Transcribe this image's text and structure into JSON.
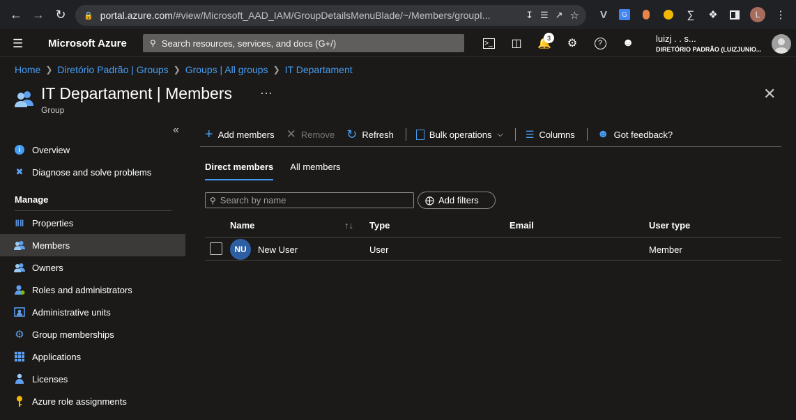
{
  "browser": {
    "url_host": "portal.azure.com",
    "url_path": "/#view/Microsoft_AAD_IAM/GroupDetailsMenuBlade/~/Members/groupI...",
    "profile_initial": "L"
  },
  "topbar": {
    "brand": "Microsoft Azure",
    "search_placeholder": "Search resources, services, and docs (G+/)",
    "notification_count": "3",
    "account_name": "luizj          .         .       s...",
    "account_directory": "DIRETÓRIO PADRÃO (LUIZJUNIO..."
  },
  "breadcrumb": [
    "Home",
    "Diretório Padrão | Groups",
    "Groups | All groups",
    "IT Departament"
  ],
  "page": {
    "title": "IT Departament | Members",
    "subtitle": "Group"
  },
  "sidebar": {
    "top_items": [
      {
        "label": "Overview",
        "icon": "info-icon"
      },
      {
        "label": "Diagnose and solve problems",
        "icon": "wrench-icon"
      }
    ],
    "section_header": "Manage",
    "manage_items": [
      {
        "label": "Properties",
        "icon": "properties-icon"
      },
      {
        "label": "Members",
        "icon": "members-icon"
      },
      {
        "label": "Owners",
        "icon": "owners-icon"
      },
      {
        "label": "Roles and administrators",
        "icon": "roles-icon"
      },
      {
        "label": "Administrative units",
        "icon": "admin-units-icon"
      },
      {
        "label": "Group memberships",
        "icon": "gear-icon"
      },
      {
        "label": "Applications",
        "icon": "grid-icon"
      },
      {
        "label": "Licenses",
        "icon": "licenses-icon"
      },
      {
        "label": "Azure role assignments",
        "icon": "key-icon"
      }
    ]
  },
  "toolbar": {
    "add_members": "Add members",
    "remove": "Remove",
    "refresh": "Refresh",
    "bulk_operations": "Bulk operations",
    "columns": "Columns",
    "feedback": "Got feedback?"
  },
  "tabs": [
    "Direct members",
    "All members"
  ],
  "filters": {
    "search_placeholder": "Search by name",
    "add_filters": "Add filters"
  },
  "table": {
    "columns": [
      "Name",
      "Type",
      "Email",
      "User type"
    ],
    "rows": [
      {
        "initials": "NU",
        "name": "New User",
        "type": "User",
        "email": "",
        "user_type": "Member"
      }
    ]
  },
  "colors": {
    "accent": "#479ef5",
    "background": "#1b1a19",
    "active_item": "#3b3a39"
  }
}
